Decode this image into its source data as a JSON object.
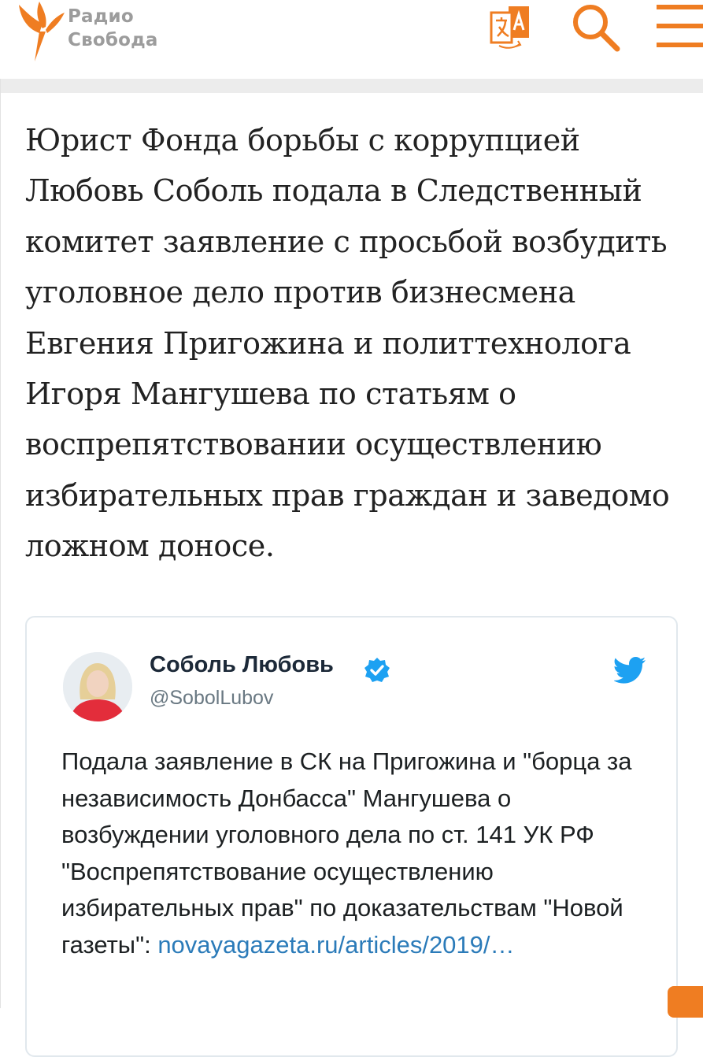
{
  "header": {
    "logo": {
      "line1": "Радио",
      "line2": "Свобода"
    },
    "icons": [
      "translate-icon",
      "search-icon",
      "menu-icon"
    ],
    "accent_color": "#ef7d22"
  },
  "article": {
    "lead": "Юрист Фонда борьбы с коррупцией Любовь Соболь подала в Следственный комитет заявление с просьбой возбудить уголовное дело против бизнесмена Евгения Пригожина и политтехнолога Игоря Мангушева по статьям о воспрепятствовании осуществлению избирательных прав граждан и заведомо ложном доносе."
  },
  "tweet": {
    "author_name": "Соболь Любовь",
    "handle": "@SobolLubov",
    "text": "Подала заявление в СК на Пригожина и \"борца за независимость Донбасса\" Мангушева о возбуждении уголовного дела по ст. 141 УК РФ \"Воспрепятствование осуществлению избирательных прав\" по доказательствам \"Новой газеты\": ",
    "link_text": "novayagazeta.ru/articles/2019/…",
    "link_color": "#2b7bb9",
    "verified_color": "#1da1f2"
  }
}
